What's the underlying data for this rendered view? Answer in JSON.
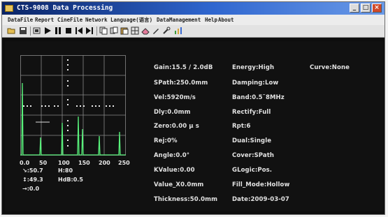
{
  "window": {
    "title": "CTS-9008 Data Processing"
  },
  "menu": {
    "items": [
      "DataFile",
      "Report",
      "CineFile",
      "Network",
      "Language(语言)",
      "DataManagement",
      "Help",
      "About"
    ]
  },
  "toolbar": {
    "icons": [
      "open-folder-icon",
      "save-icon",
      "record-icon",
      "play-icon",
      "pause-icon",
      "stop-icon",
      "first-frame-icon",
      "last-frame-icon",
      "copy-icon",
      "copy-all-icon",
      "paste-icon",
      "grid-icon",
      "eraser-icon",
      "pen-icon",
      "wrench-icon",
      "chart-icon"
    ]
  },
  "graph": {
    "x_ticks": [
      "0.0",
      "50",
      "100",
      "150",
      "200",
      "250"
    ],
    "readouts": {
      "angle_marker": "↘:50.7",
      "h_value": "H:80",
      "depth_marker": "↕:49.3",
      "hdb_value": "HdB:0.5",
      "arrow_marker": "→:0.0"
    },
    "colors": {
      "grid": "#8a8a8a",
      "trace": "#58f07a",
      "dots": "#ececec"
    }
  },
  "params": {
    "col1": [
      "Gain:15.5 / 2.0dB",
      "SPath:250.0mm",
      "Vel:5920m/s",
      "Dly:0.0mm",
      "Zero:0.00 μ s",
      "Rej:0%",
      "Angle:0.0°",
      "KValue:0.00",
      "Value_X0.0mm",
      "Thickness:50.0mm"
    ],
    "col2": [
      "Energy:High",
      "Damping:Low",
      "Band:0.5˜8MHz",
      "Rectify:Full",
      "Rpt:6",
      "Dual:Single",
      "Cover:SPath",
      "GLogic:Pos.",
      "Fill_Mode:Hollow",
      "Date:2009-03-07"
    ],
    "col3": [
      "Curve:None"
    ]
  }
}
